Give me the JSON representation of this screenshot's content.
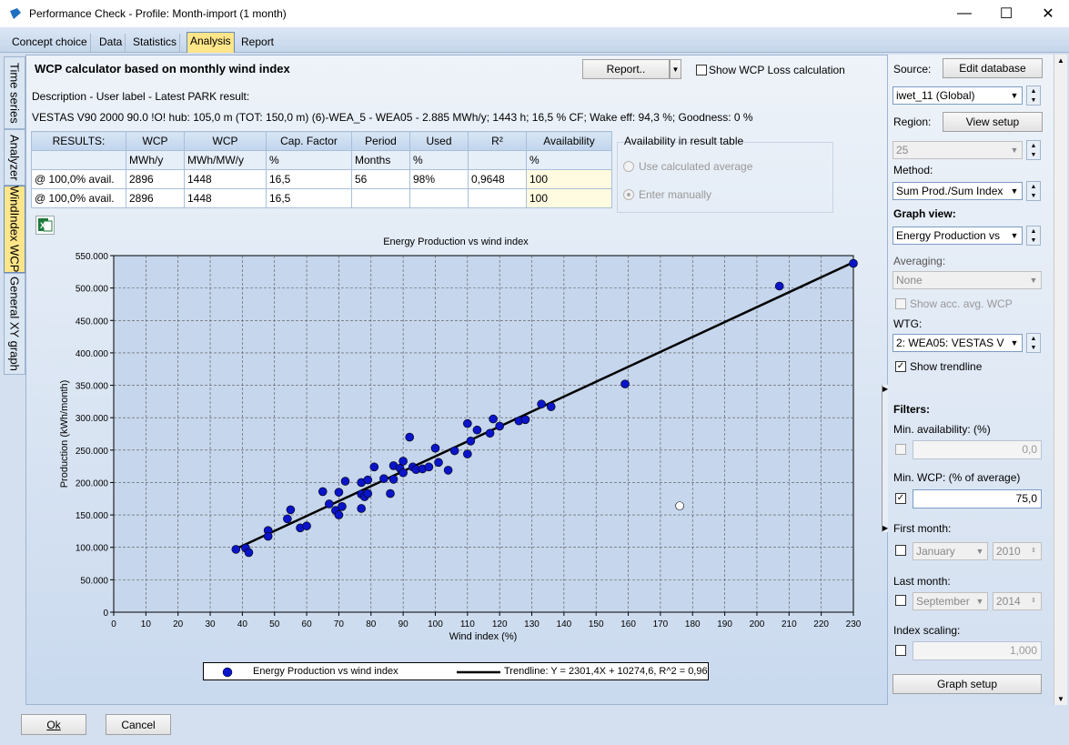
{
  "window": {
    "title": "Performance Check - Profile: Month-import (1 month)"
  },
  "tabs": [
    "Concept choice",
    "Data",
    "Statistics",
    "Analysis",
    "Report"
  ],
  "side_tabs": [
    "Time series",
    "Analyzer",
    "WindIndex WCP",
    "General XY graph"
  ],
  "main": {
    "heading": "WCP calculator based on monthly wind index",
    "report_button": "Report..",
    "show_loss_label": "Show WCP Loss calculation",
    "description_label": "Description - User label - Latest PARK result:",
    "description_value": "VESTAS V90 2000 90.0 !O! hub: 105,0 m (TOT: 150,0 m) (6)-WEA_5 - WEA05 -  2.885 MWh/y;  1443 h;  16,5 % CF;  Wake eff: 94,3 %;  Goodness: 0 %"
  },
  "results": {
    "headers": [
      "RESULTS:",
      "WCP",
      "WCP",
      "Cap. Factor",
      "Period",
      "Used",
      "R²",
      "Availability"
    ],
    "units": [
      "",
      "MWh/y",
      "MWh/MW/y",
      "%",
      "Months",
      "%",
      "",
      "%"
    ],
    "rows": [
      [
        "@ 100,0% avail.",
        "2896",
        "1448",
        "16,5",
        "56",
        "98%",
        "0,9648",
        "100"
      ],
      [
        "@ 100,0% avail.",
        "2896",
        "1448",
        "16,5",
        "",
        "",
        "",
        "100"
      ]
    ]
  },
  "availability": {
    "title": "Availability in result table",
    "option_calc": "Use calculated average",
    "option_manual": "Enter manually"
  },
  "chart_data": {
    "type": "scatter",
    "title": "Energy Production vs wind index",
    "xlabel": "Wind index (%)",
    "ylabel": "Production (kWh/month)",
    "xlim": [
      0,
      230
    ],
    "ylim": [
      0,
      550000
    ],
    "x_ticks": [
      "0",
      "10",
      "20",
      "30",
      "40",
      "50",
      "60",
      "70",
      "80",
      "90",
      "100",
      "110",
      "120",
      "130",
      "140",
      "150",
      "160",
      "170",
      "180",
      "190",
      "200",
      "210",
      "220",
      "230"
    ],
    "y_ticks": [
      "0",
      "50.000",
      "100.000",
      "150.000",
      "200.000",
      "250.000",
      "300.000",
      "350.000",
      "400.000",
      "450.000",
      "500.000",
      "550.000"
    ],
    "grid": true,
    "series": [
      {
        "name": "Energy Production vs wind index",
        "color": "#0a14c8",
        "points": [
          [
            38,
            97000
          ],
          [
            41,
            99000
          ],
          [
            42,
            92000
          ],
          [
            48,
            126000
          ],
          [
            48,
            117000
          ],
          [
            54,
            144000
          ],
          [
            55,
            158000
          ],
          [
            58,
            130000
          ],
          [
            60,
            133000
          ],
          [
            65,
            186000
          ],
          [
            67,
            167000
          ],
          [
            69,
            157000
          ],
          [
            70,
            150000
          ],
          [
            70,
            185000
          ],
          [
            71,
            163000
          ],
          [
            72,
            202000
          ],
          [
            77,
            160000
          ],
          [
            77,
            182000
          ],
          [
            77,
            200000
          ],
          [
            78,
            178000
          ],
          [
            79,
            204000
          ],
          [
            79,
            183000
          ],
          [
            81,
            224000
          ],
          [
            84,
            206000
          ],
          [
            86,
            183000
          ],
          [
            87,
            226000
          ],
          [
            87,
            205000
          ],
          [
            89,
            222000
          ],
          [
            90,
            233000
          ],
          [
            90,
            215000
          ],
          [
            92,
            270000
          ],
          [
            93,
            224000
          ],
          [
            94,
            220000
          ],
          [
            96,
            221000
          ],
          [
            98,
            224000
          ],
          [
            100,
            253000
          ],
          [
            101,
            231000
          ],
          [
            104,
            219000
          ],
          [
            106,
            249000
          ],
          [
            110,
            244000
          ],
          [
            110,
            291000
          ],
          [
            111,
            264000
          ],
          [
            113,
            281000
          ],
          [
            117,
            276000
          ],
          [
            118,
            298000
          ],
          [
            120,
            287000
          ],
          [
            126,
            295000
          ],
          [
            128,
            297000
          ],
          [
            133,
            321000
          ],
          [
            136,
            317000
          ],
          [
            159,
            352000
          ],
          [
            207,
            503000
          ],
          [
            230,
            538000
          ]
        ]
      },
      {
        "name": "outlier",
        "color": "#ffffff",
        "points": [
          [
            176,
            164000
          ]
        ]
      }
    ],
    "trendline": {
      "name": "Trendline: Y = 2301,4X + 10274,6, R^2 = 0,96",
      "slope": 2301.4,
      "intercept": 10274.6,
      "x_range": [
        38,
        230
      ]
    }
  },
  "right": {
    "source_label": "Source:",
    "edit_db_button": "Edit database",
    "source_value": "iwet_11 (Global)",
    "region_label": "Region:",
    "view_setup_button": "View setup",
    "region_value": "25",
    "method_label": "Method:",
    "method_value": "Sum Prod./Sum Index",
    "graph_view_label": "Graph view:",
    "graph_view_value": "Energy Production vs",
    "averaging_label": "Averaging:",
    "averaging_value": "None",
    "show_acc_label": "Show acc. avg. WCP",
    "wtg_label": "WTG:",
    "wtg_value": "2: WEA05: VESTAS V",
    "show_trendline_label": "Show trendline",
    "filters_label": "Filters:",
    "min_avail_label": "Min. availability: (%)",
    "min_avail_value": "0,0",
    "min_wcp_label": "Min. WCP: (% of average)",
    "min_wcp_value": "75,0",
    "first_month_label": "First month:",
    "first_month_value": "January",
    "first_year_value": "2010",
    "last_month_label": "Last month:",
    "last_month_value": "September",
    "last_year_value": "2014",
    "index_scaling_label": "Index scaling:",
    "index_scaling_value": "1,000",
    "graph_setup_button": "Graph setup"
  },
  "footer": {
    "ok": "Ok",
    "cancel": "Cancel"
  }
}
